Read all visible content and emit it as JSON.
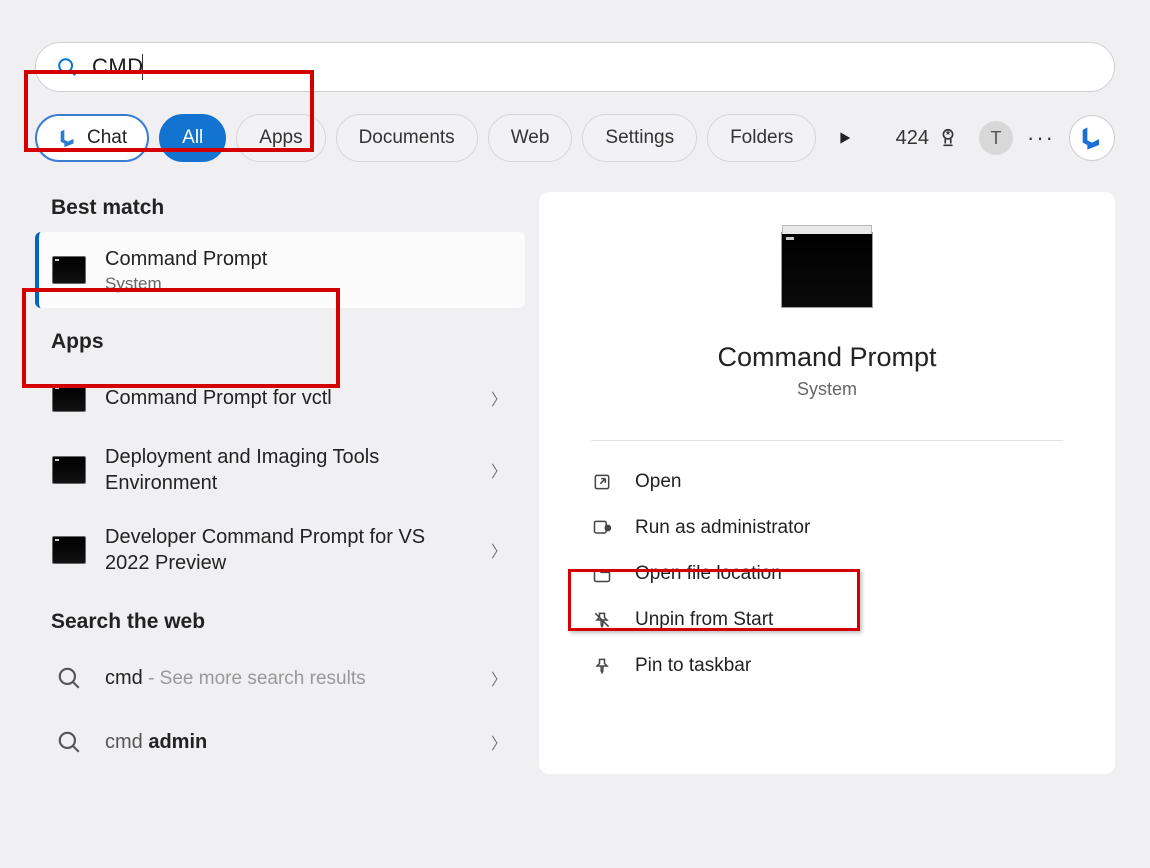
{
  "search": {
    "query": "CMD"
  },
  "filters": {
    "chat": "Chat",
    "all": "All",
    "apps": "Apps",
    "documents": "Documents",
    "web": "Web",
    "settings": "Settings",
    "folders": "Folders"
  },
  "topbar": {
    "points": "424",
    "avatar_initial": "T"
  },
  "left": {
    "best_match_header": "Best match",
    "best_match": {
      "title": "Command Prompt",
      "subtitle": "System"
    },
    "apps_header": "Apps",
    "apps": [
      {
        "title": "Command Prompt for vctl"
      },
      {
        "title": "Deployment and Imaging Tools Environment"
      },
      {
        "title": "Developer Command Prompt for VS 2022 Preview"
      }
    ],
    "web_header": "Search the web",
    "web": [
      {
        "term": "cmd",
        "suffix": " - See more search results"
      },
      {
        "prefix": "cmd ",
        "bold": "admin"
      }
    ]
  },
  "right": {
    "title": "Command Prompt",
    "subtitle": "System",
    "actions": {
      "open": "Open",
      "admin": "Run as administrator",
      "location": "Open file location",
      "unpin": "Unpin from Start",
      "pin": "Pin to taskbar"
    }
  }
}
